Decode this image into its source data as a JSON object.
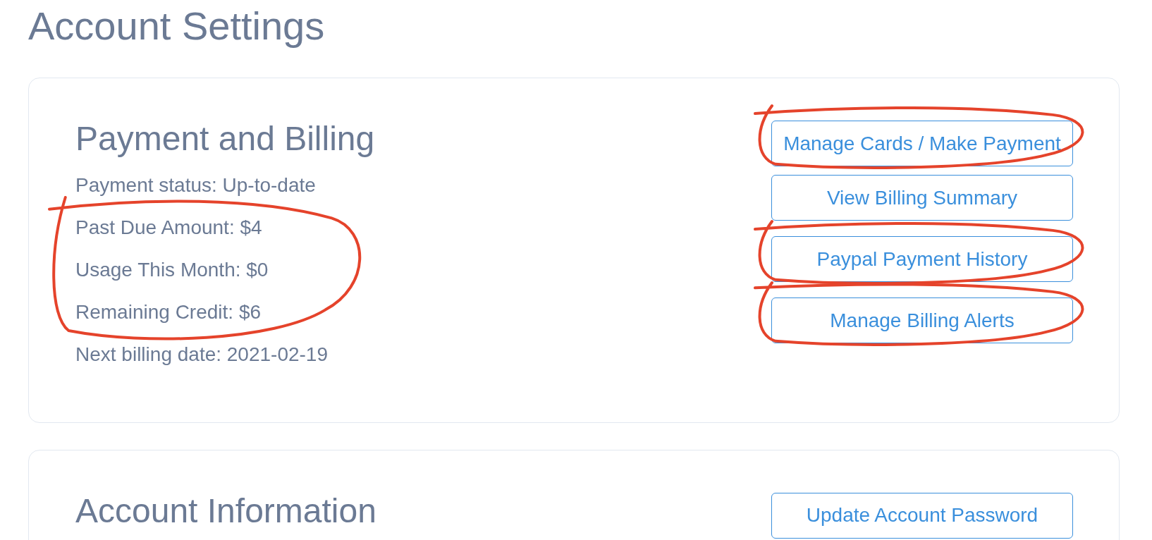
{
  "page_title": "Account Settings",
  "sections": [
    {
      "title": "Payment and Billing",
      "lines": [
        {
          "text": "Payment status: Up-to-date",
          "circled": false
        },
        {
          "text": "Past Due Amount: $4",
          "circled": true
        },
        {
          "text": "Usage This Month: $0",
          "circled": true
        },
        {
          "text": "Remaining Credit: $6",
          "circled": true
        },
        {
          "text": "Next billing date: 2021-02-19",
          "circled": false
        }
      ],
      "buttons": [
        {
          "label": "Manage Cards / Make Payment",
          "circled": true
        },
        {
          "label": "View Billing Summary",
          "circled": false
        },
        {
          "label": "Paypal Payment History",
          "circled": true
        },
        {
          "label": "Manage Billing Alerts",
          "circled": true
        }
      ]
    },
    {
      "title": "Account Information",
      "buttons": [
        {
          "label": "Update Account Password",
          "circled": false
        }
      ]
    }
  ]
}
